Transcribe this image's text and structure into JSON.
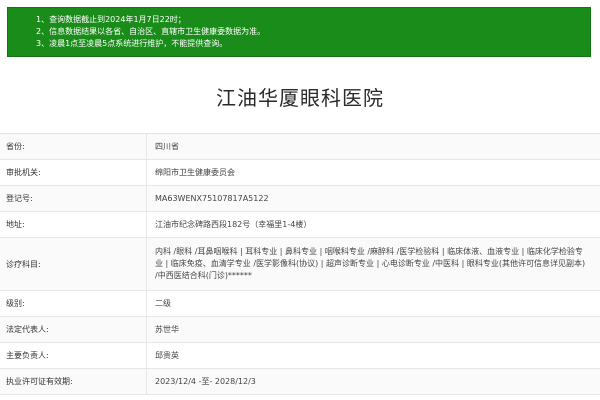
{
  "notice": {
    "lines": [
      "1、查询数据截止到2024年1月7日22时；",
      "2、信息数据结果以各省、自治区、直辖市卫生健康委数据为准。",
      "3、凌晨1点至凌晨5点系统进行维护，不能提供查询。"
    ]
  },
  "hospital_name": "江油华厦眼科医院",
  "rows": [
    {
      "label": "省份:",
      "value": "四川省"
    },
    {
      "label": "审批机关:",
      "value": "绵阳市卫生健康委员会"
    },
    {
      "label": "登记号:",
      "value": "MA63WENX75107817A5122"
    },
    {
      "label": "地址:",
      "value": "江油市纪念碑路西段182号（幸福里1-4楼）"
    },
    {
      "label": "诊疗科目:",
      "value": "内科 /眼科 /耳鼻咽喉科 | 耳科专业 | 鼻科专业 | 咽喉科专业 /麻醉科 /医学检验科 | 临床体液、血液专业 | 临床化学检验专业 | 临床免疫、血清学专业 /医学影像科(协议) | 超声诊断专业 | 心电诊断专业 /中医科 | 眼科专业(其他许可信息详见副本) /中西医结合科(门诊)******"
    },
    {
      "label": "级别:",
      "value": "二级"
    },
    {
      "label": "法定代表人:",
      "value": "苏世华"
    },
    {
      "label": "主要负责人:",
      "value": "邱贵英"
    },
    {
      "label": "执业许可证有效期:",
      "value": "2023/12/4 -至- 2028/12/3"
    }
  ]
}
